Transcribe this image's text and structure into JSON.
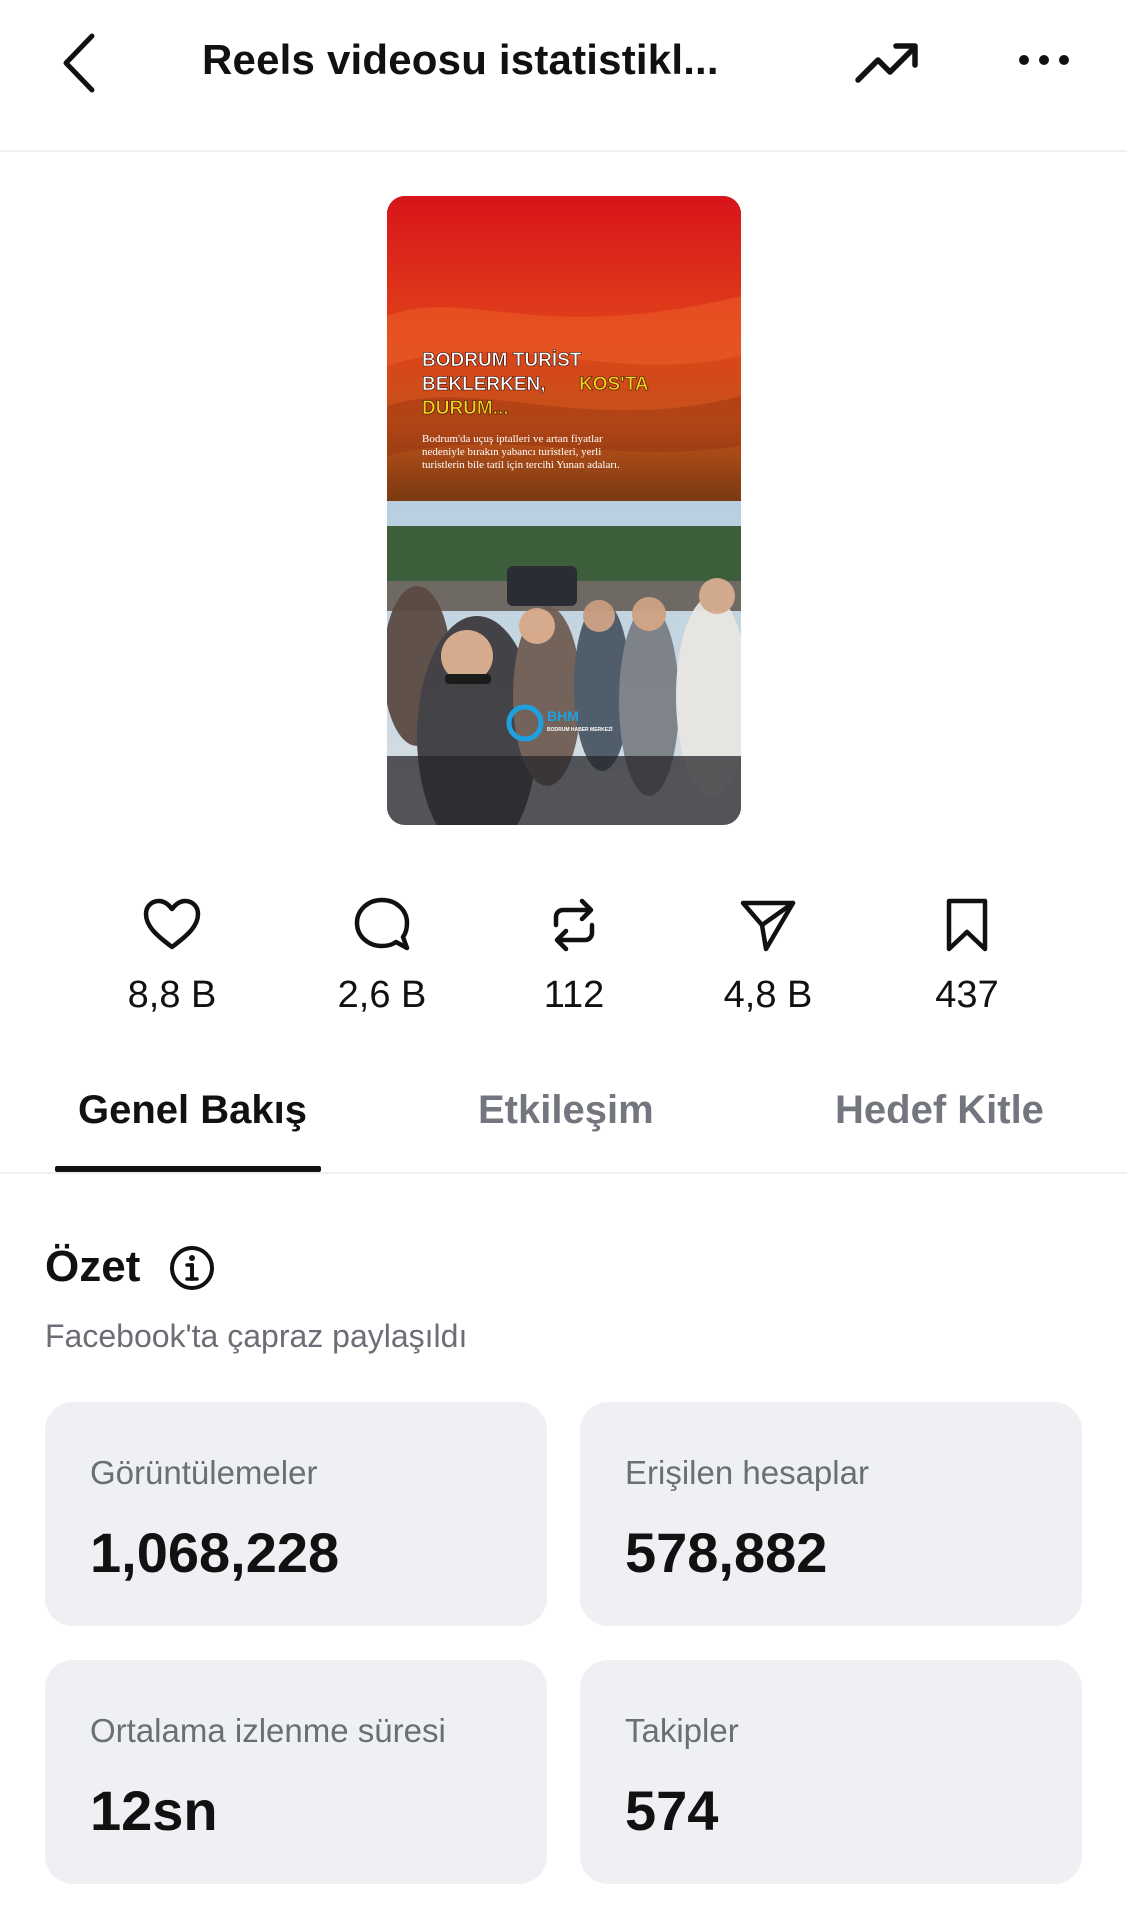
{
  "header": {
    "title": "Reels videosu istatistikl..."
  },
  "thumbnail": {
    "headline_1": "BODRUM TURİST",
    "headline_2a": "BEKLERKEN, ",
    "headline_2b": "KOS'TA",
    "headline_3": "DURUM...",
    "body_1": "Bodrum'da uçuş iptalleri ve artan fiyatlar",
    "body_2": "nedeniyle bırakın yabancı turistleri, yerli",
    "body_3": "turistlerin bile tatil için tercihi Yunan adaları.",
    "logo_text": "BHM",
    "logo_sub": "BODRUM HABER MERKEZİ"
  },
  "stats": {
    "likes": "8,8 B",
    "comments": "2,6 B",
    "reposts": "112",
    "shares": "4,8 B",
    "saves": "437"
  },
  "tabs": [
    {
      "label": "Genel Bakış",
      "active": true
    },
    {
      "label": "Etkileşim",
      "active": false
    },
    {
      "label": "Hedef Kitle",
      "active": false
    }
  ],
  "summary": {
    "title": "Özet",
    "subtitle": "Facebook'ta çapraz paylaşıldı"
  },
  "cards": [
    {
      "label": "Görüntülemeler",
      "value": "1,068,228"
    },
    {
      "label": "Erişilen hesaplar",
      "value": "578,882"
    },
    {
      "label": "Ortalama izlenme süresi",
      "value": "12sn"
    },
    {
      "label": "Takipler",
      "value": "574"
    }
  ],
  "colors": {
    "text": "#111111",
    "muted": "#6b6e75",
    "card_bg": "#eff0f4",
    "thumb_red": "#d8141a",
    "thumb_yellow": "#f6d21a"
  }
}
